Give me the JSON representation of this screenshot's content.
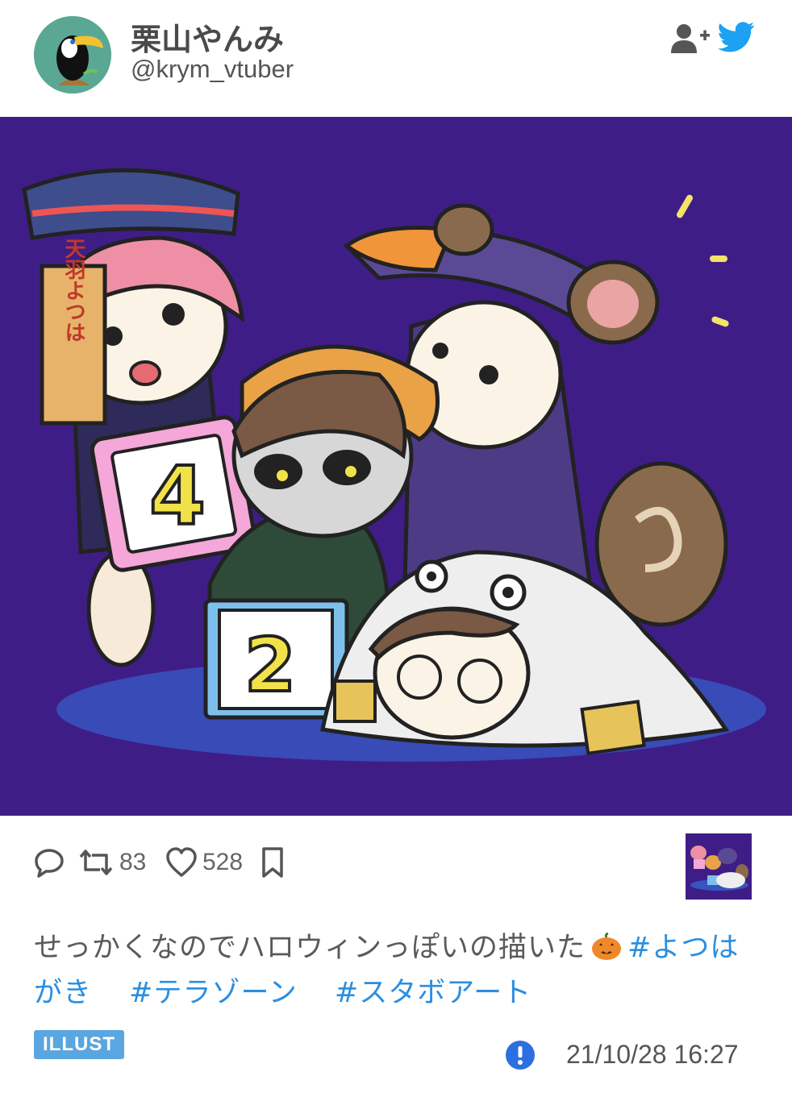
{
  "user": {
    "display_name": "栗山やんみ",
    "handle": "@krym_vtuber"
  },
  "actions": {
    "retweets": "83",
    "likes": "528"
  },
  "tweet": {
    "text": "せっかくなのでハロウィンっぽいの描いた",
    "emoji": "pumpkin-emoji",
    "hashtags": [
      "#よつはがき",
      "#テラゾーン",
      "#スタボアート"
    ]
  },
  "post": {
    "type_badge": "ILLUST",
    "timestamp": "21/10/28 16:27"
  },
  "colors": {
    "link": "#2b8ee0",
    "badge": "#5aa6e0",
    "twitter": "#1da1f2",
    "artwork_bg": "#3f1d86"
  },
  "artwork": {
    "sign_text": "天羽よつは",
    "card_left": "4",
    "card_right": "2"
  }
}
